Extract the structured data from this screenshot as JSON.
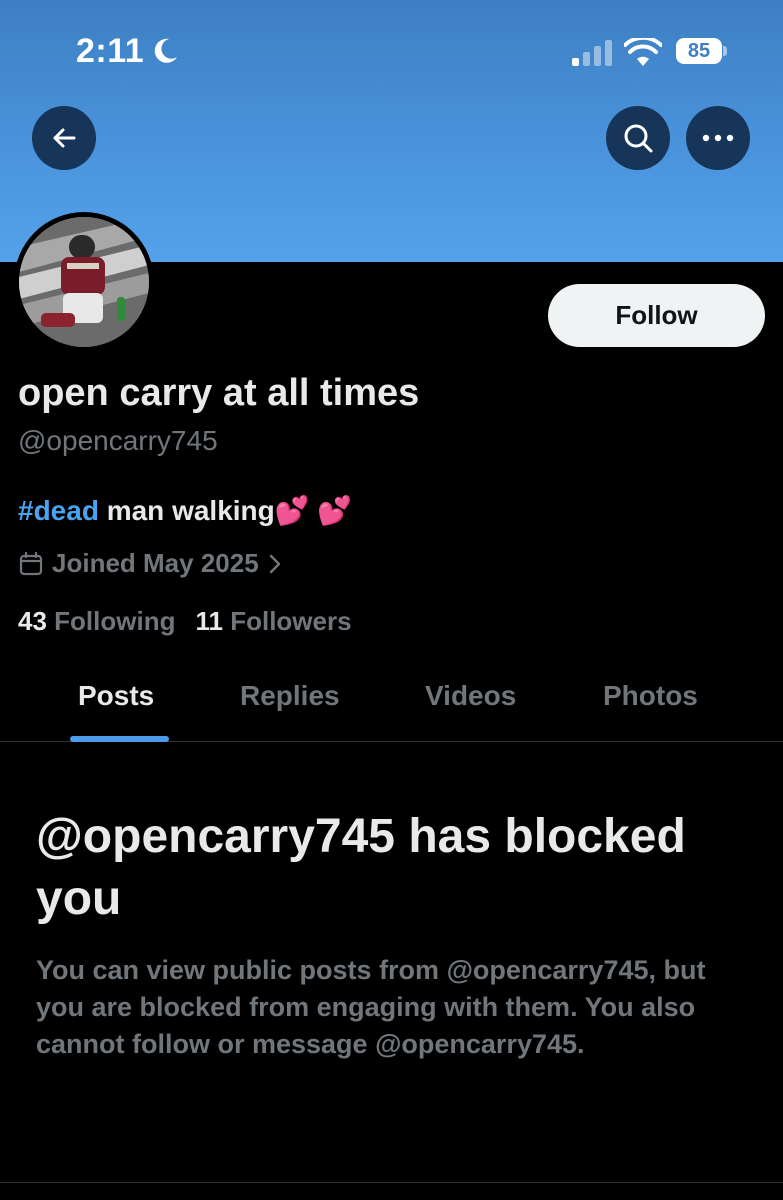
{
  "status_bar": {
    "time": "2:11",
    "battery": "85"
  },
  "profile": {
    "display_name": "open carry at all times",
    "handle": "@opencarry745",
    "bio_hashtag": "#dead",
    "bio_text": " man walking💕 💕",
    "joined": "Joined May 2025",
    "following_count": "43",
    "following_label": "Following",
    "followers_count": "11",
    "followers_label": "Followers",
    "follow_label": "Follow"
  },
  "tabs": [
    {
      "label": "Posts",
      "active": true
    },
    {
      "label": "Replies",
      "active": false
    },
    {
      "label": "Videos",
      "active": false
    },
    {
      "label": "Photos",
      "active": false
    }
  ],
  "blocked": {
    "title": "@opencarry745 has blocked you",
    "message": "You can view public posts from @opencarry745, but you are blocked from engaging with them. You also cannot follow or message @opencarry745."
  },
  "colors": {
    "banner": "#4a93dc",
    "accent": "#4aa3ef",
    "background": "#000000",
    "muted_text": "#71767b"
  },
  "icons": [
    "moon-icon",
    "cellular-signal-icon",
    "wifi-icon",
    "battery-icon",
    "back-arrow-icon",
    "search-icon",
    "more-icon",
    "calendar-icon",
    "chevron-right-icon"
  ]
}
